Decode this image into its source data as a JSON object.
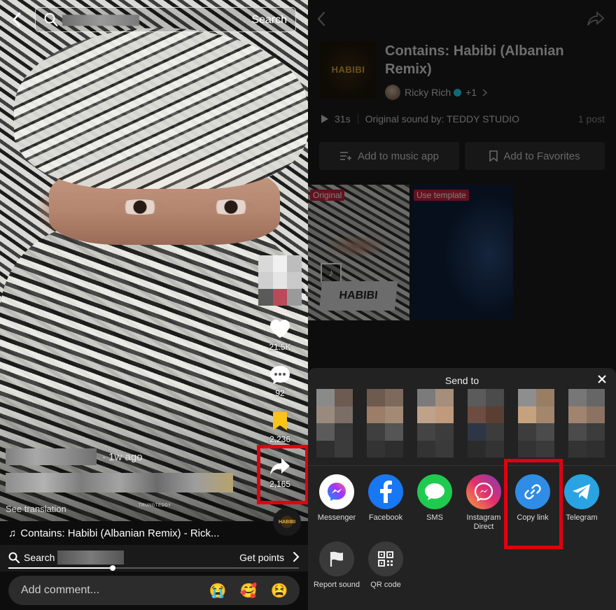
{
  "left": {
    "search": {
      "button_label": "Search"
    },
    "rail": {
      "likes": "21.5K",
      "comments": "92",
      "saves": "2,236",
      "shares": "2,165"
    },
    "post": {
      "time_ago": "· 1w ago",
      "see_translation": "See translation",
      "watermark": "TRUNGTEDDY"
    },
    "music": {
      "text": "Contains: Habibi (Albanian Remix) - Rick...",
      "disc_label": "HABIBI"
    },
    "bottom_search": {
      "label": "Search ·",
      "points": "Get points"
    },
    "progress": 0.36,
    "comment": {
      "placeholder": "Add comment...",
      "emojis": [
        "😭",
        "🥰",
        "😫"
      ]
    }
  },
  "right": {
    "cover_text": "HABIBI",
    "title": "Contains: Habibi (Albanian Remix)",
    "artist": "Ricky Rich",
    "artist_extra": "+1",
    "duration": "31s",
    "original_sound": "Original sound by: TEDDY STUDIO",
    "posts": "1 post",
    "add_music_app": "Add to music app",
    "add_favorites": "Add to Favorites",
    "thumb_tags": [
      "Original",
      "Use template"
    ],
    "thumb_card": "HABIBI",
    "sheet": {
      "title": "Send to",
      "apps": [
        {
          "label": "Messenger",
          "icon": "messenger-icon"
        },
        {
          "label": "Facebook",
          "icon": "facebook-icon"
        },
        {
          "label": "SMS",
          "icon": "sms-icon"
        },
        {
          "label": "Instagram Direct",
          "icon": "instagram-direct-icon"
        },
        {
          "label": "Copy link",
          "icon": "link-icon"
        },
        {
          "label": "Telegram",
          "icon": "telegram-icon"
        },
        {
          "label": "Report sound",
          "icon": "flag-icon"
        },
        {
          "label": "QR code",
          "icon": "qr-code-icon"
        }
      ]
    }
  },
  "colors": {
    "highlight": "#e10010",
    "tiktok_cyan": "#20d5ec",
    "tag_red": "#c8233c"
  }
}
